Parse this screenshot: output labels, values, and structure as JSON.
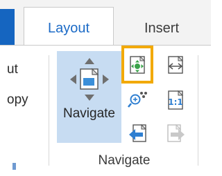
{
  "tabs": {
    "layout": "Layout",
    "insert": "Insert"
  },
  "left_group": {
    "item1": "ut",
    "item2": "opy"
  },
  "navigate_group": {
    "big_button_label": "Navigate",
    "group_label": "Navigate",
    "small_buttons": [
      {
        "icon": "zoom-to-extent-icon",
        "highlighted": true
      },
      {
        "icon": "fixed-zoom-out-icon",
        "highlighted": false
      },
      {
        "icon": "zoom-to-selected-icon",
        "highlighted": false
      },
      {
        "icon": "zoom-100-percent-icon",
        "highlighted": false
      },
      {
        "icon": "previous-extent-icon",
        "highlighted": false
      },
      {
        "icon": "next-extent-icon",
        "highlighted": false
      }
    ]
  },
  "colors": {
    "accent": "#1b6ac6",
    "highlight": "#f2a900",
    "selected_bg": "#c7dcf2"
  }
}
